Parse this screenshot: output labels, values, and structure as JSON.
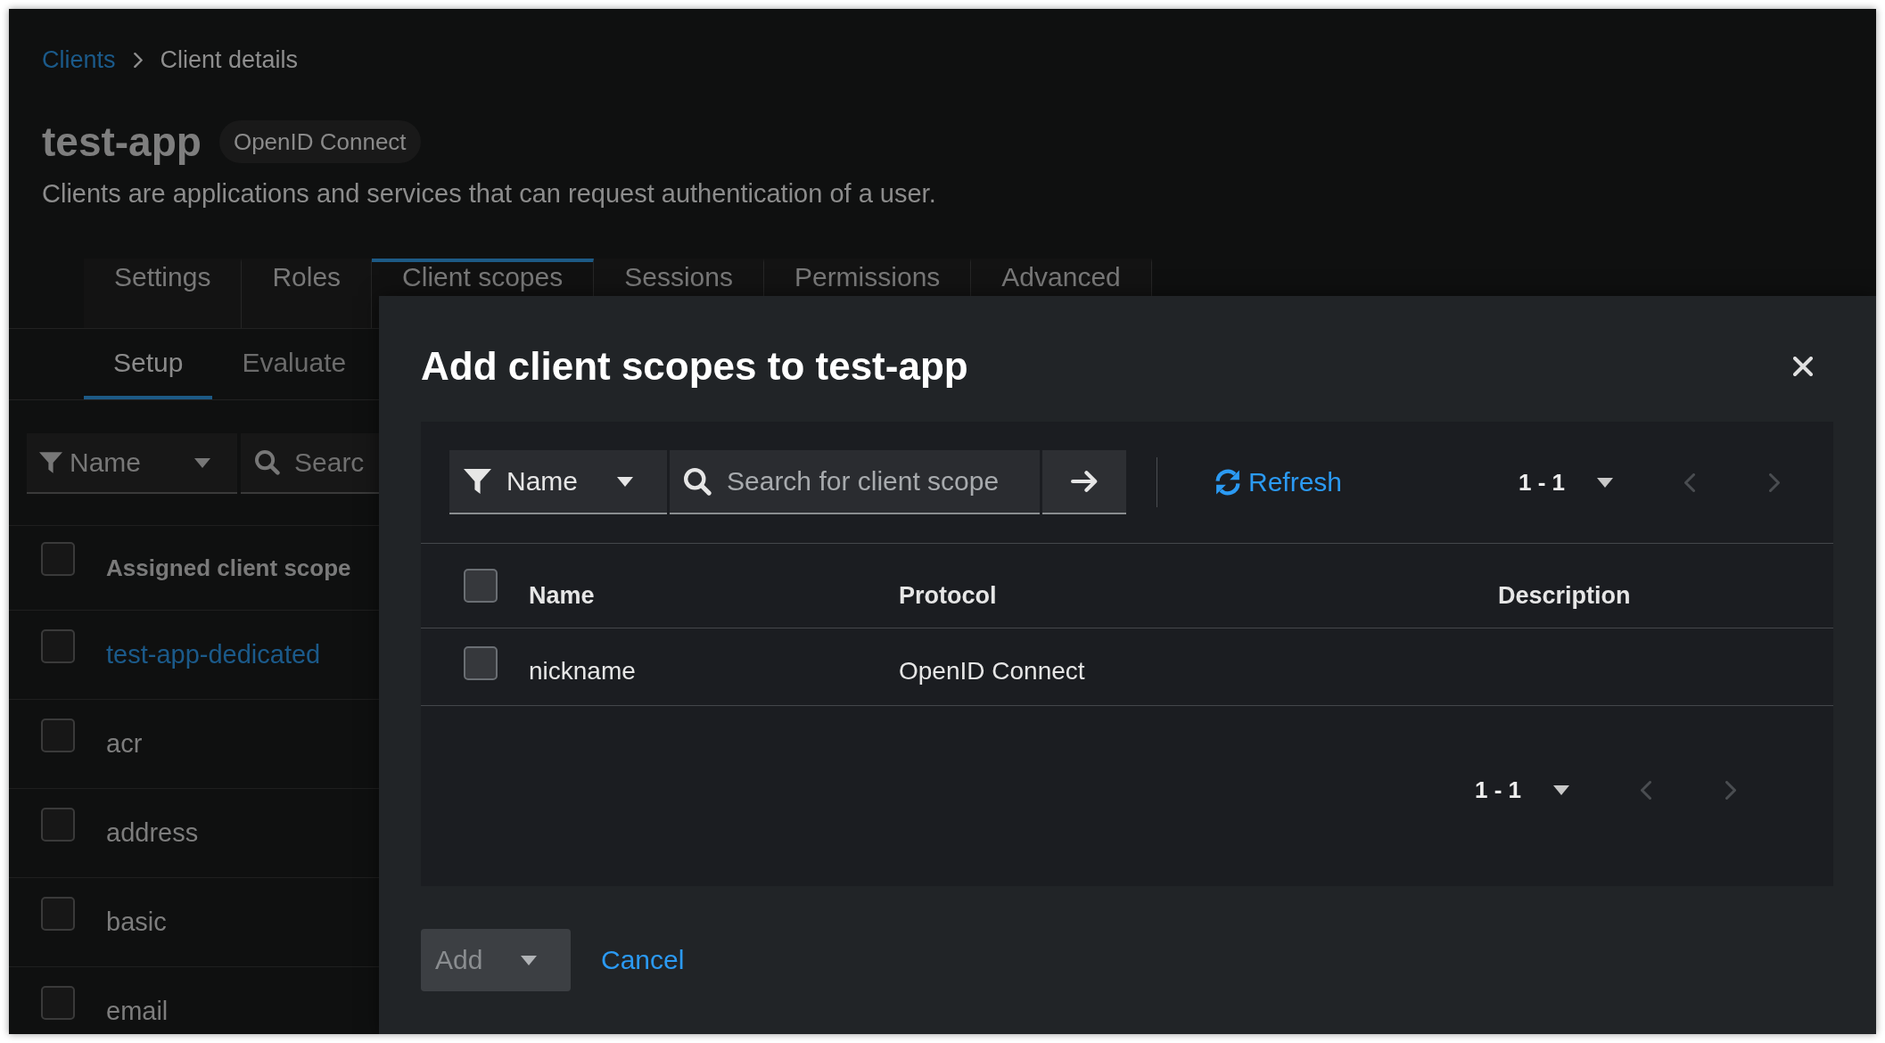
{
  "breadcrumb": [
    {
      "label": "Clients",
      "kind": "link"
    },
    {
      "label": "Client details",
      "kind": "current"
    }
  ],
  "header": {
    "title": "test-app",
    "badge": "OpenID Connect",
    "description": "Clients are applications and services that can request authentication of a user."
  },
  "tabs": [
    {
      "label": "Settings",
      "selected": false
    },
    {
      "label": "Roles",
      "selected": false
    },
    {
      "label": "Client scopes",
      "selected": true
    },
    {
      "label": "Sessions",
      "selected": false
    },
    {
      "label": "Permissions",
      "selected": false
    },
    {
      "label": "Advanced",
      "selected": false
    }
  ],
  "subtabs": [
    {
      "label": "Setup",
      "selected": true
    },
    {
      "label": "Evaluate",
      "selected": false
    }
  ],
  "toolbar": {
    "filter": "Name",
    "search": {
      "placeholder": "Searc"
    }
  },
  "scopes_table": {
    "header": {
      "label": "Assigned client scope",
      "checked": false
    },
    "rows": [
      {
        "name": "test-app-dedicated",
        "kind": "link",
        "checked": false
      },
      {
        "name": "acr",
        "kind": "text",
        "checked": false
      },
      {
        "name": "address",
        "kind": "text",
        "checked": false
      },
      {
        "name": "basic",
        "kind": "text",
        "checked": false
      },
      {
        "name": "email",
        "kind": "text",
        "checked": false
      }
    ]
  },
  "modal": {
    "title": "Add client scopes to test-app",
    "toolbar": {
      "filter": "Name",
      "search": {
        "placeholder": "Search for client scope"
      },
      "refresh": "Refresh",
      "pagination": {
        "range": "1 - 1",
        "previous_disabled": true,
        "next_disabled": true
      }
    },
    "table": {
      "columns": [
        "Name",
        "Protocol",
        "Description"
      ],
      "header_checked": false,
      "rows": [
        {
          "name": "nickname",
          "protocol": "OpenID Connect",
          "checked": false
        }
      ]
    },
    "bottom_pagination": {
      "range": "1 - 1",
      "previous_disabled": true,
      "next_disabled": true
    },
    "footer": {
      "add": {
        "label": "Add",
        "disabled": true
      },
      "cancel": "Cancel"
    }
  }
}
